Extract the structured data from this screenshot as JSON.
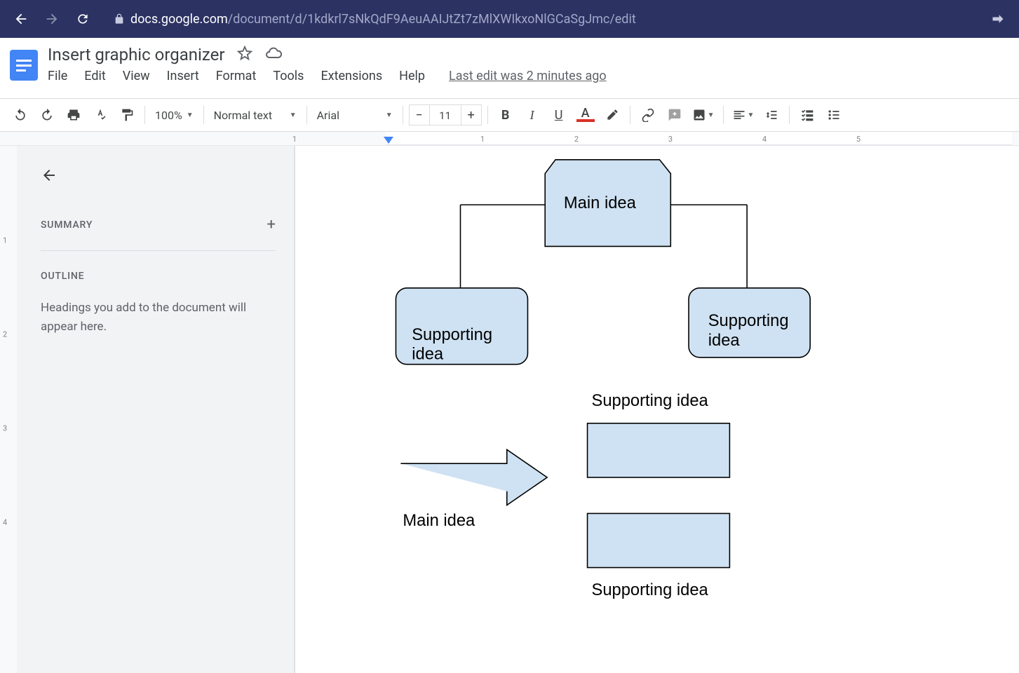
{
  "browser": {
    "url_host": "docs.google.com",
    "url_path": "/document/d/1kdkrl7sNkQdF9AeuAAIJtZt7zMlXWIkxoNlGCaSgJmc/edit"
  },
  "doc": {
    "title": "Insert graphic organizer",
    "last_edit": "Last edit was 2 minutes ago"
  },
  "menu": {
    "file": "File",
    "edit": "Edit",
    "view": "View",
    "insert": "Insert",
    "format": "Format",
    "tools": "Tools",
    "extensions": "Extensions",
    "help": "Help"
  },
  "toolbar": {
    "zoom": "100%",
    "style": "Normal text",
    "font": "Arial",
    "font_size": "11"
  },
  "sidebar": {
    "summary": "SUMMARY",
    "outline": "OUTLINE",
    "outline_hint": "Headings you add to the document will appear here."
  },
  "ruler": {
    "n1": "1",
    "n2": "2",
    "n3": "3",
    "n4": "4",
    "n5": "5"
  },
  "diagram": {
    "main_idea": "Main idea",
    "supporting_idea": "Supporting idea",
    "supporting_idea2_l1": "Supporting",
    "supporting_idea2_l2": "idea",
    "supporting_idea3_l1": "Supporting",
    "supporting_idea3_l2": "idea",
    "main_idea2": "Main idea",
    "supporting_top": "Supporting idea",
    "supporting_bottom": "Supporting idea"
  }
}
